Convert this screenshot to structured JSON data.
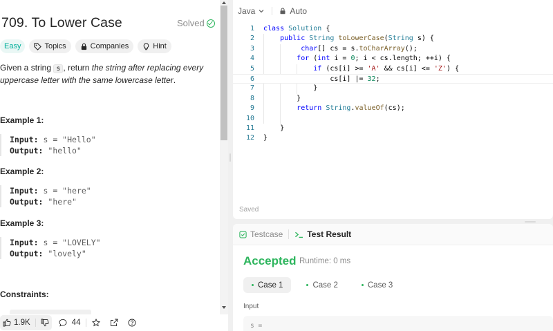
{
  "problem": {
    "title": "709. To Lower Case",
    "solved_label": "Solved",
    "tags": [
      "Easy",
      "Topics",
      "Companies",
      "Hint"
    ],
    "desc_part1": "Given a string ",
    "desc_code": "s",
    "desc_part2": ", return ",
    "desc_italic": "the string after replacing every uppercase letter with the same lowercase letter",
    "desc_end": ".",
    "examples": [
      {
        "heading": "Example 1:",
        "input_label": "Input:",
        "input": " s = \"Hello\"",
        "output_label": "Output:",
        "output": " \"hello\""
      },
      {
        "heading": "Example 2:",
        "input_label": "Input:",
        "input": " s = \"here\"",
        "output_label": "Output:",
        "output": " \"here\""
      },
      {
        "heading": "Example 3:",
        "input_label": "Input:",
        "input": " s = \"LOVELY\"",
        "output_label": "Output:",
        "output": " \"lovely\""
      }
    ],
    "constraints_heading": "Constraints:"
  },
  "bottombar": {
    "likes": "1.9K",
    "comments": "44"
  },
  "editor": {
    "language": "Java",
    "mode": "Auto",
    "status": "Saved",
    "line_numbers": [
      "1",
      "2",
      "3",
      "4",
      "5",
      "6",
      "7",
      "8",
      "9",
      "10",
      "11",
      "12"
    ]
  },
  "result": {
    "tab_testcase": "Testcase",
    "tab_result": "Test Result",
    "verdict": "Accepted",
    "runtime": "Runtime: 0 ms",
    "cases": [
      "Case 1",
      "Case 2",
      "Case 3"
    ],
    "input_label": "Input",
    "input_peek": "s ="
  },
  "colors": {
    "accent_green": "#2db55d",
    "easy_teal": "#00af9b"
  }
}
